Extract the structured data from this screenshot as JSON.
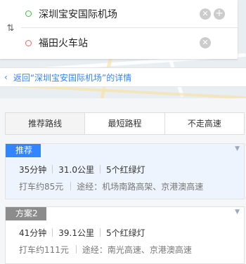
{
  "route": {
    "start": "深圳宝安国际机场",
    "end": "福田火车站"
  },
  "back_link": "返回“深圳宝安国际机场”的详情",
  "tabs": [
    "推荐路线",
    "最短路程",
    "不走高速"
  ],
  "routes": [
    {
      "label": "推荐",
      "time": "35分钟",
      "distance": "31.0公里",
      "lights": "5个红绿灯",
      "taxi": "打车约85元",
      "via": "途经：机场南路高架、京港澳高速"
    },
    {
      "label": "方案2",
      "time": "41分钟",
      "distance": "39.1公里",
      "lights": "5个红绿灯",
      "taxi": "打车约111元",
      "via": "途经：南光高速、京港澳高速"
    }
  ],
  "colors": {
    "accent": "#3385ff",
    "label_gray": "#8c8c8c",
    "start_dot": "#33cc33",
    "end_dot": "#ee6666"
  }
}
